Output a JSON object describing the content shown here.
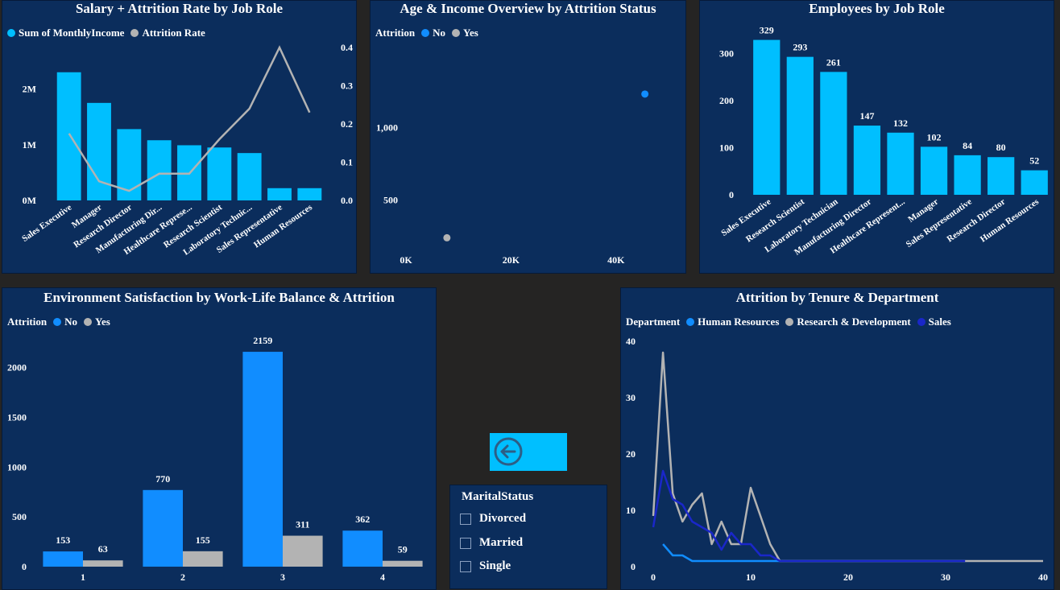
{
  "colors": {
    "cyan": "#00bfff",
    "blue": "#118dff",
    "gray": "#b3b3b3",
    "navy": "#1a27c9",
    "panel": "#0b2d5c",
    "background": "#252423"
  },
  "back_button": {
    "icon": "arrow-left-circle-icon"
  },
  "slicer": {
    "title": "MaritalStatus",
    "options": [
      "Divorced",
      "Married",
      "Single"
    ]
  },
  "chart_data": [
    {
      "id": "salary_attrition",
      "type": "bar",
      "title": "Salary + Attrition Rate by Job Role",
      "legend": [
        "Sum of MonthlyIncome",
        "Attrition Rate"
      ],
      "categories": [
        "Sales Executive",
        "Manager",
        "Research Director",
        "Manufacturing Dir...",
        "Healthcare Represe...",
        "Research Scientist",
        "Laboratory Technic...",
        "Sales Representative",
        "Human Resources"
      ],
      "series": [
        {
          "name": "Sum of MonthlyIncome",
          "type": "bar",
          "axis": "left",
          "values": [
            2300000,
            1750000,
            1280000,
            1080000,
            990000,
            950000,
            850000,
            220000,
            220000
          ]
        },
        {
          "name": "Attrition Rate",
          "type": "line",
          "axis": "right",
          "values": [
            0.175,
            0.05,
            0.025,
            0.07,
            0.07,
            0.16,
            0.24,
            0.4,
            0.23
          ]
        }
      ],
      "y_left": {
        "ticks": [
          0,
          1000000,
          2000000
        ],
        "tick_labels": [
          "0M",
          "1M",
          "2M"
        ],
        "range": [
          0,
          2600000
        ]
      },
      "y_right": {
        "ticks": [
          0,
          0.1,
          0.2,
          0.3,
          0.4
        ],
        "tick_labels": [
          "0.0",
          "0.1",
          "0.2",
          "0.3",
          "0.4"
        ],
        "range": [
          0,
          0.4
        ]
      }
    },
    {
      "id": "age_income",
      "type": "scatter",
      "title": "Age & Income Overview by Attrition Status",
      "legend_title": "Attrition",
      "legend": [
        "No",
        "Yes"
      ],
      "series": [
        {
          "name": "No",
          "points": [
            [
              45500,
              1233
            ]
          ]
        },
        {
          "name": "Yes",
          "points": [
            [
              7800,
              237
            ]
          ]
        }
      ],
      "x_ticks": [
        0,
        20000,
        40000
      ],
      "x_tick_labels": [
        "0K",
        "20K",
        "40K"
      ],
      "xlim": [
        0,
        50000
      ],
      "y_ticks": [
        500,
        1000
      ],
      "y_tick_labels": [
        "500",
        "1,000"
      ],
      "ylim": [
        150,
        1500
      ]
    },
    {
      "id": "employees_job_role",
      "type": "bar",
      "title": "Employees by Job Role",
      "categories": [
        "Sales Executive",
        "Research Scientist",
        "Laboratory Technician",
        "Manufacturing Director",
        "Healthcare Represent...",
        "Manager",
        "Sales Representative",
        "Research Director",
        "Human Resources"
      ],
      "values": [
        329,
        293,
        261,
        147,
        132,
        102,
        84,
        80,
        52
      ],
      "data_labels": [
        "329",
        "293",
        "261",
        "147",
        "132",
        "102",
        "84",
        "80",
        "52"
      ],
      "y_ticks": [
        0,
        100,
        200,
        300
      ],
      "ylim": [
        0,
        330
      ]
    },
    {
      "id": "env_satisfaction",
      "type": "bar",
      "title": "Environment Satisfaction by Work-Life Balance & Attrition",
      "legend_title": "Attrition",
      "legend": [
        "No",
        "Yes"
      ],
      "categories": [
        "1",
        "2",
        "3",
        "4"
      ],
      "series": [
        {
          "name": "No",
          "values": [
            153,
            770,
            2159,
            362
          ]
        },
        {
          "name": "Yes",
          "values": [
            63,
            155,
            311,
            59
          ]
        }
      ],
      "y_ticks": [
        0,
        500,
        1000,
        1500,
        2000
      ],
      "ylim": [
        0,
        2200
      ]
    },
    {
      "id": "attrition_tenure",
      "type": "line",
      "title": "Attrition by Tenure & Department",
      "legend_title": "Department",
      "legend": [
        "Human Resources",
        "Research & Development",
        "Sales"
      ],
      "series": [
        {
          "name": "Human Resources",
          "x": [
            1,
            2,
            3,
            4,
            5,
            6,
            7,
            8,
            9,
            10,
            11,
            12,
            13,
            14,
            15,
            20,
            25,
            32
          ],
          "y": [
            4,
            2,
            2,
            1,
            1,
            1,
            1,
            1,
            1,
            1,
            1,
            1,
            1,
            1,
            1,
            1,
            1,
            1
          ]
        },
        {
          "name": "Research & Development",
          "x": [
            0,
            1,
            2,
            3,
            4,
            5,
            6,
            7,
            8,
            9,
            10,
            11,
            12,
            13,
            14,
            15,
            20,
            25,
            30,
            35,
            40
          ],
          "y": [
            9,
            38,
            13,
            8,
            11,
            13,
            4,
            8,
            4,
            4,
            14,
            9,
            4,
            1,
            1,
            1,
            1,
            1,
            1,
            1,
            1
          ]
        },
        {
          "name": "Sales",
          "x": [
            0,
            1,
            2,
            3,
            4,
            5,
            6,
            7,
            8,
            9,
            10,
            11,
            12,
            13,
            14,
            15,
            20,
            25,
            32
          ],
          "y": [
            7,
            17,
            12,
            11,
            8,
            7,
            6,
            3,
            6,
            4,
            4,
            2,
            2,
            1,
            1,
            1,
            1,
            1,
            1
          ]
        }
      ],
      "x_ticks": [
        0,
        10,
        20,
        30,
        40
      ],
      "xlim": [
        0,
        40
      ],
      "y_ticks": [
        0,
        10,
        20,
        30,
        40
      ],
      "ylim": [
        0,
        40
      ]
    }
  ]
}
